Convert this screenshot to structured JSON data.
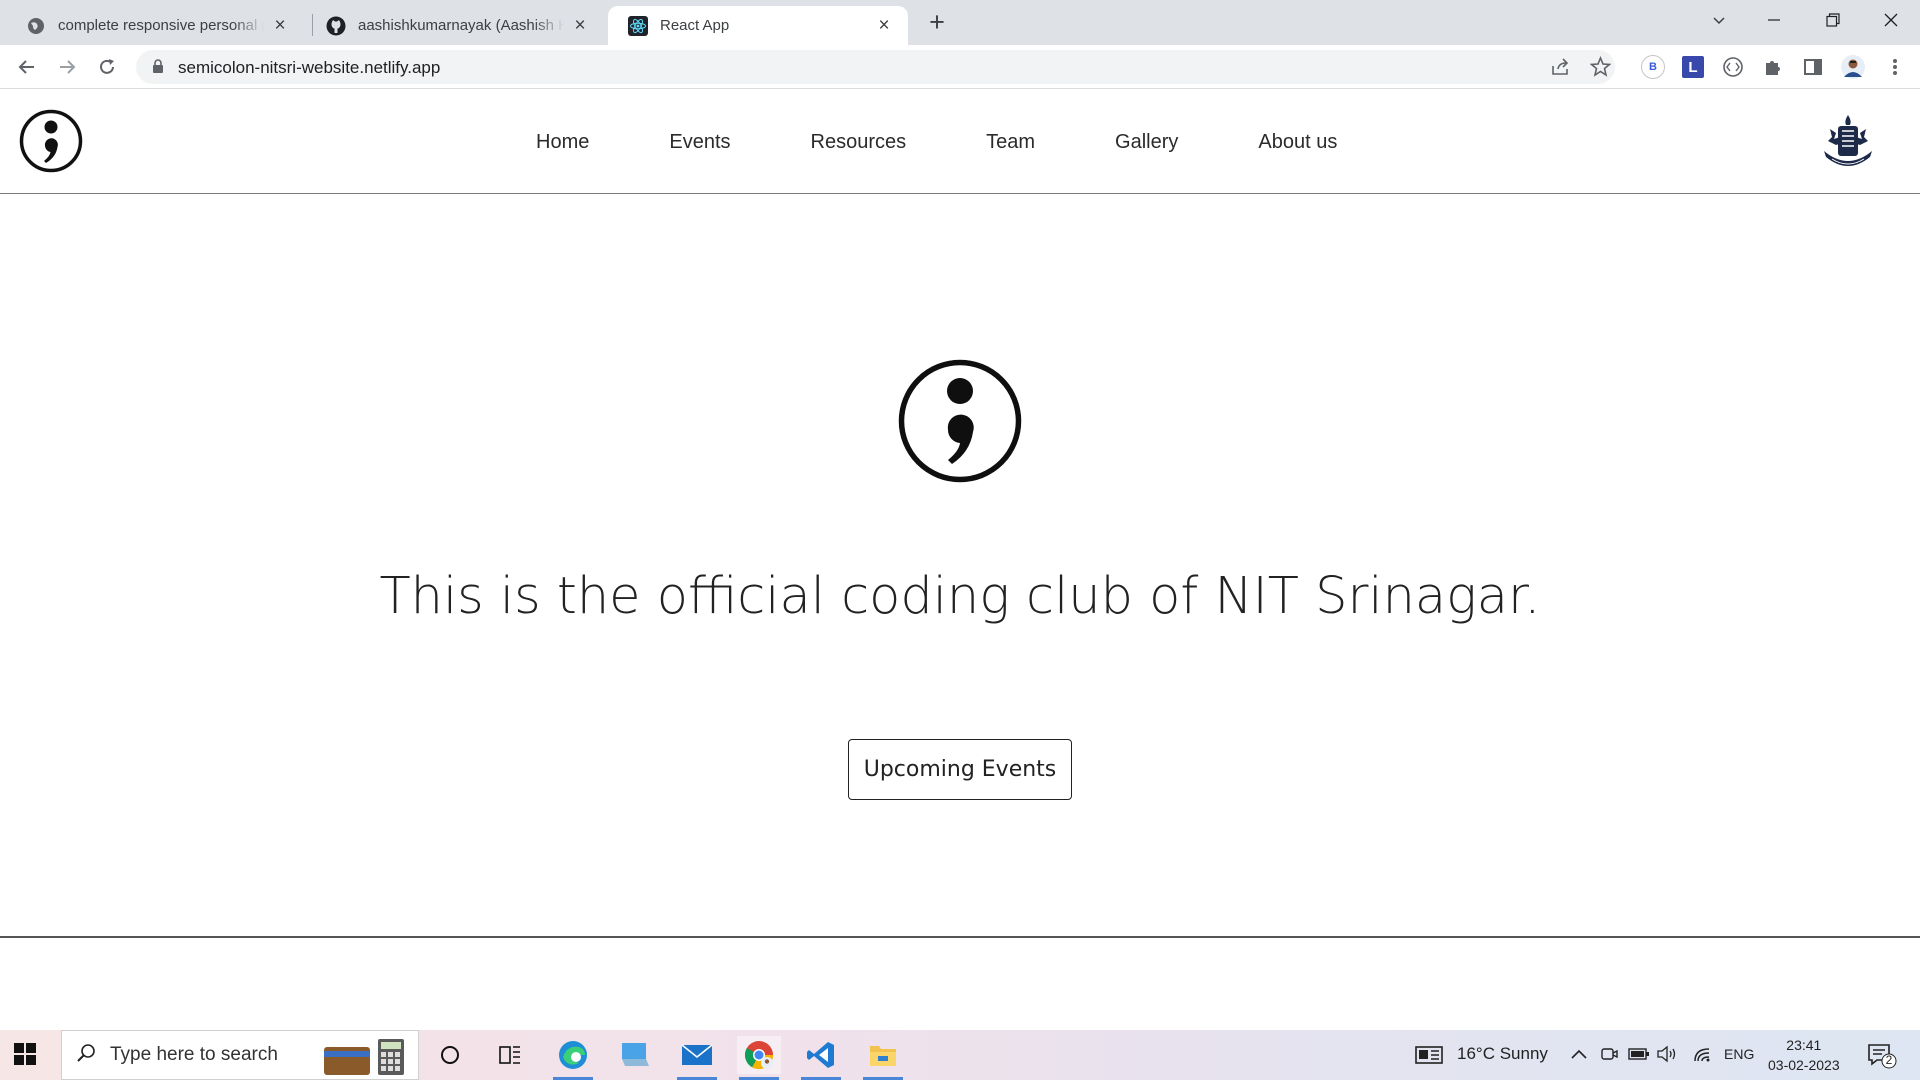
{
  "browser": {
    "tabs": [
      {
        "title": "complete responsive personal po",
        "icon": "globe-icon",
        "active": false
      },
      {
        "title": "aashishkumarnayak (Aashish Kum",
        "icon": "github-icon",
        "active": false
      },
      {
        "title": "React App",
        "icon": "react-icon",
        "active": true
      }
    ],
    "url": "semicolon-nitsri-website.netlify.app",
    "extension_b_label": "B",
    "extension_l_label": "L"
  },
  "site": {
    "nav": {
      "links": [
        "Home",
        "Events",
        "Resources",
        "Team",
        "Gallery",
        "About us"
      ]
    },
    "hero": {
      "tagline": "This is the official coding club of NIT Srinagar.",
      "cta_label": "Upcoming Events"
    }
  },
  "taskbar": {
    "search_placeholder": "Type here to search",
    "weather": "16°C  Sunny",
    "language": "ENG",
    "time": "23:41",
    "date": "03-02-2023",
    "notifications": "2"
  }
}
